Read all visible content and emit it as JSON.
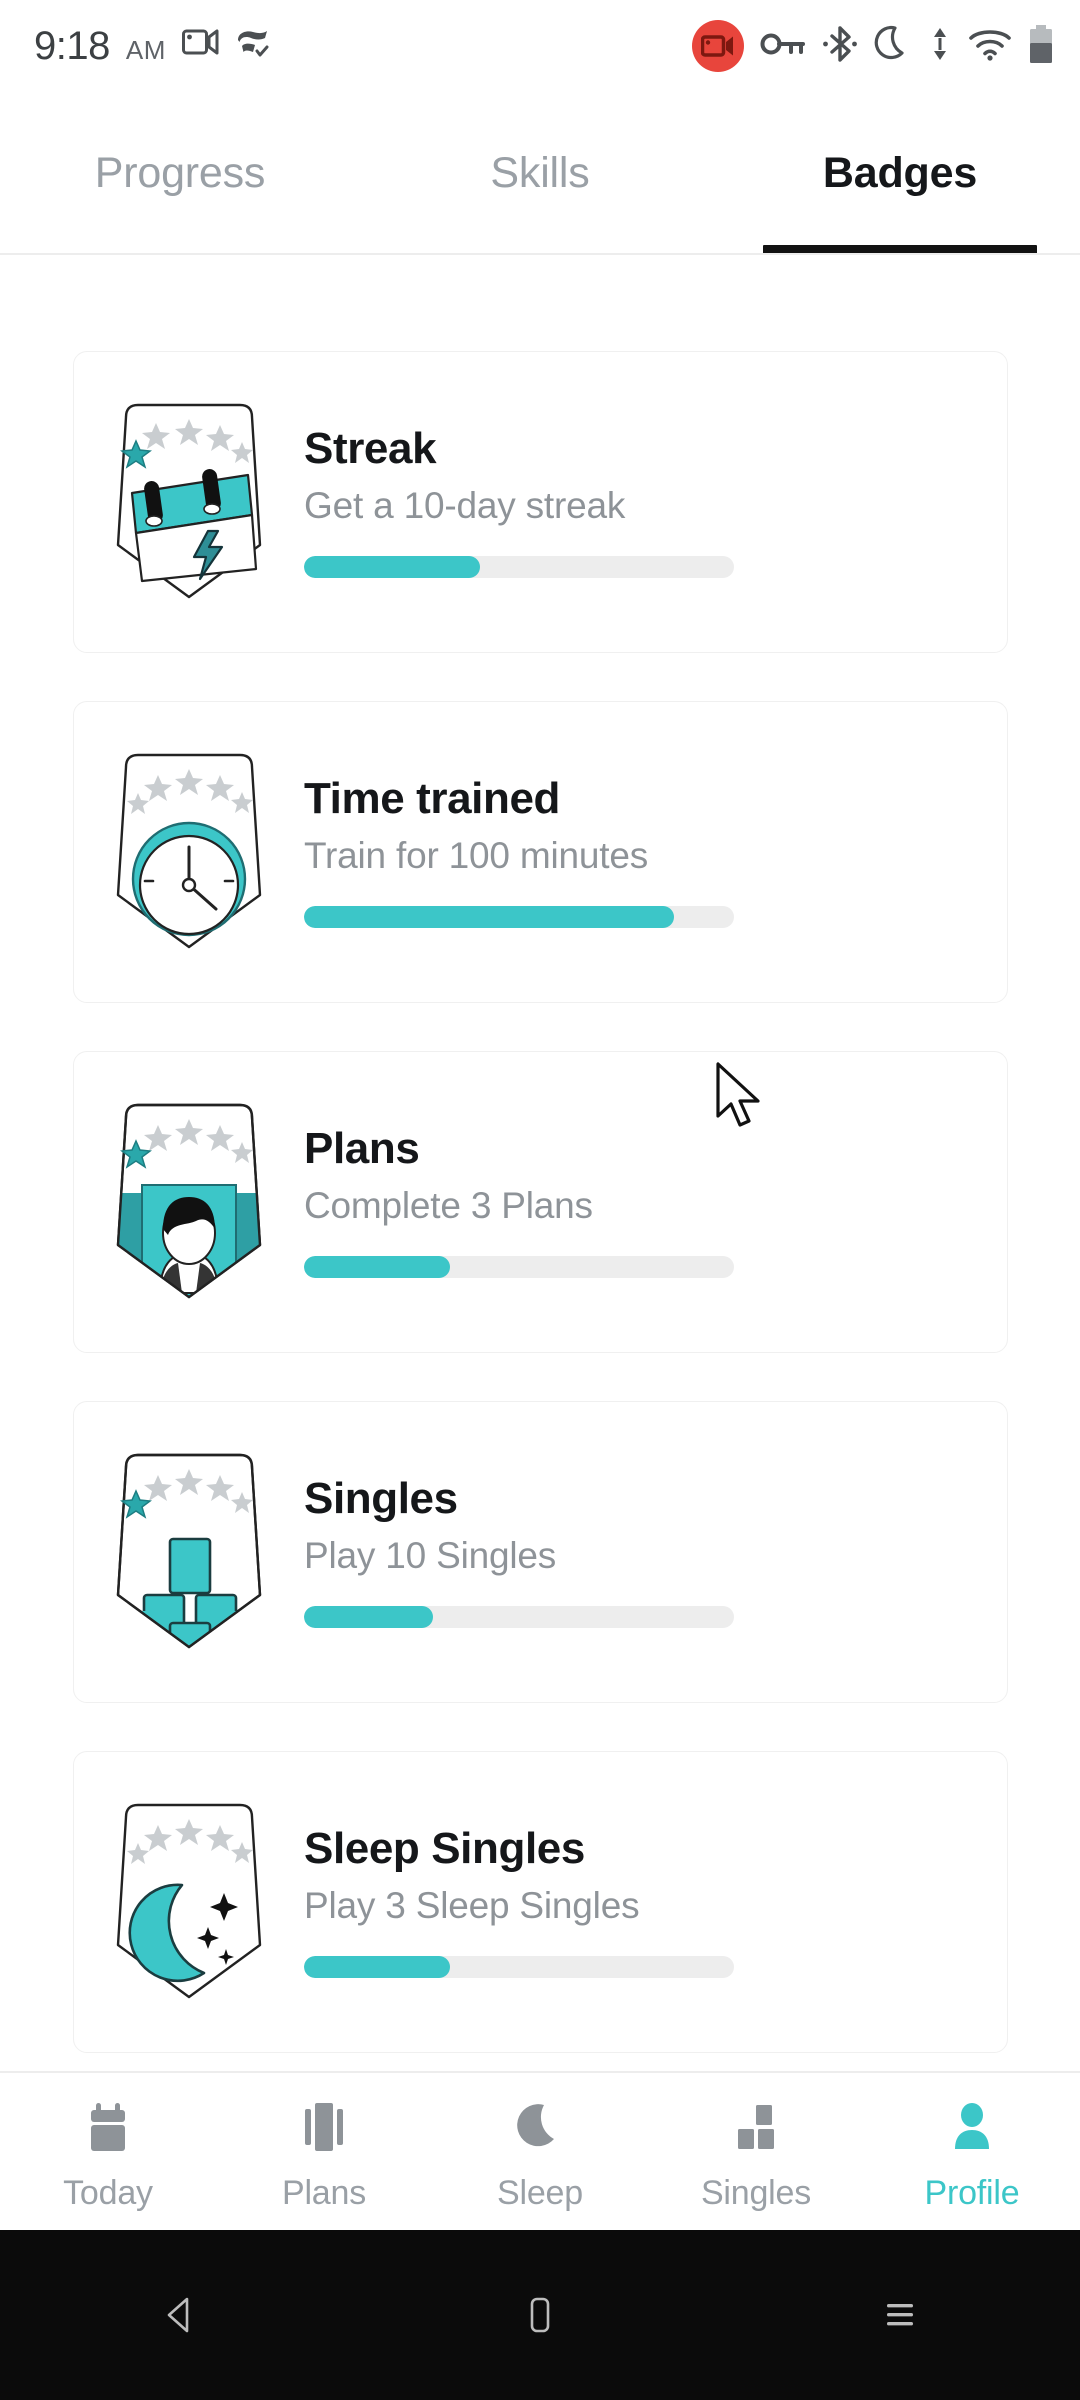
{
  "statusbar": {
    "time": "9:18",
    "ampm": "AM",
    "icons_left": [
      "screen-cast-icon",
      "vpn-check-icon"
    ],
    "icons_right": [
      "screen-record-icon",
      "vpn-key-icon",
      "bluetooth-icon",
      "do-not-disturb-moon-icon",
      "data-transfer-icon",
      "wifi-icon",
      "battery-icon"
    ],
    "record_badge_color": "#e8453c"
  },
  "tabs": {
    "items": [
      {
        "label": "Progress",
        "active": false
      },
      {
        "label": "Skills",
        "active": false
      },
      {
        "label": "Badges",
        "active": true
      }
    ]
  },
  "badges": {
    "items": [
      {
        "icon": "calendar-streak-badge-icon",
        "title": "Streak",
        "subtitle": "Get a 10-day streak",
        "progress_percent": 41,
        "stars_total": 5,
        "stars_earned": 1
      },
      {
        "icon": "clock-time-trained-badge-icon",
        "title": "Time trained",
        "subtitle": "Train for 100 minutes",
        "progress_percent": 86,
        "stars_total": 5,
        "stars_earned": 0
      },
      {
        "icon": "person-plans-badge-icon",
        "title": "Plans",
        "subtitle": "Complete 3 Plans",
        "progress_percent": 34,
        "stars_total": 5,
        "stars_earned": 1
      },
      {
        "icon": "blocks-singles-badge-icon",
        "title": "Singles",
        "subtitle": "Play 10 Singles",
        "progress_percent": 30,
        "stars_total": 5,
        "stars_earned": 1
      },
      {
        "icon": "moon-sleep-singles-badge-icon",
        "title": "Sleep Singles",
        "subtitle": "Play 3 Sleep Singles",
        "progress_percent": 34,
        "stars_total": 5,
        "stars_earned": 0
      }
    ]
  },
  "bottomnav": {
    "items": [
      {
        "label": "Today",
        "icon": "calendar-icon",
        "active": false
      },
      {
        "label": "Plans",
        "icon": "columns-icon",
        "active": false
      },
      {
        "label": "Sleep",
        "icon": "moon-icon",
        "active": false
      },
      {
        "label": "Singles",
        "icon": "blocks-icon",
        "active": false
      },
      {
        "label": "Profile",
        "icon": "person-icon",
        "active": true
      }
    ]
  },
  "sysnav": {
    "buttons": [
      "back-icon",
      "home-icon",
      "recents-icon"
    ]
  },
  "colors": {
    "accent_teal": "#3cc6c8",
    "accent_teal_dark": "#2e9fa4",
    "text_primary": "#15171a",
    "text_secondary": "#8e9398",
    "track": "#ededed",
    "record_red": "#e8453c"
  }
}
